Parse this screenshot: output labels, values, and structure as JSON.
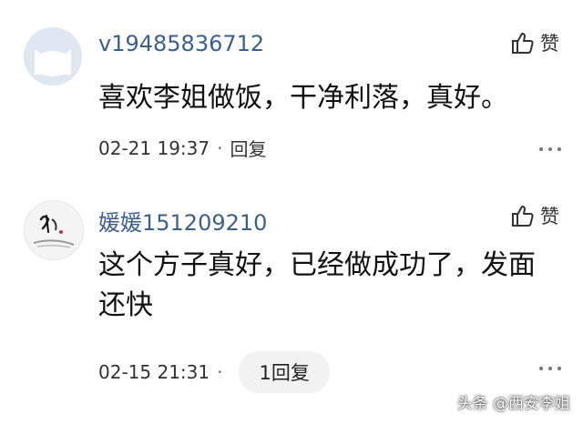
{
  "comments": [
    {
      "avatar_icon": "cat-avatar-icon",
      "username": "v19485836712",
      "like_label": "赞",
      "text": "喜欢李姐做饭，干净利落，真好。",
      "timestamp": "02-21 19:37",
      "separator": "·",
      "reply_label": "回复",
      "more_icon": "more-dots-icon"
    },
    {
      "avatar_icon": "ink-painting-avatar-icon",
      "username": "媛媛151209210",
      "like_label": "赞",
      "text": "这个方子真好，已经做成功了，发面还快",
      "timestamp": "02-15 21:31",
      "separator": "·",
      "reply_label": "1回复",
      "more_icon": "more-dots-icon"
    }
  ],
  "watermark": "头条 @西安李姐",
  "colors": {
    "username": "#3d5f8f",
    "avatar1_bg": "#dfe8f1",
    "reply_pill_bg": "#f2f2f2"
  }
}
